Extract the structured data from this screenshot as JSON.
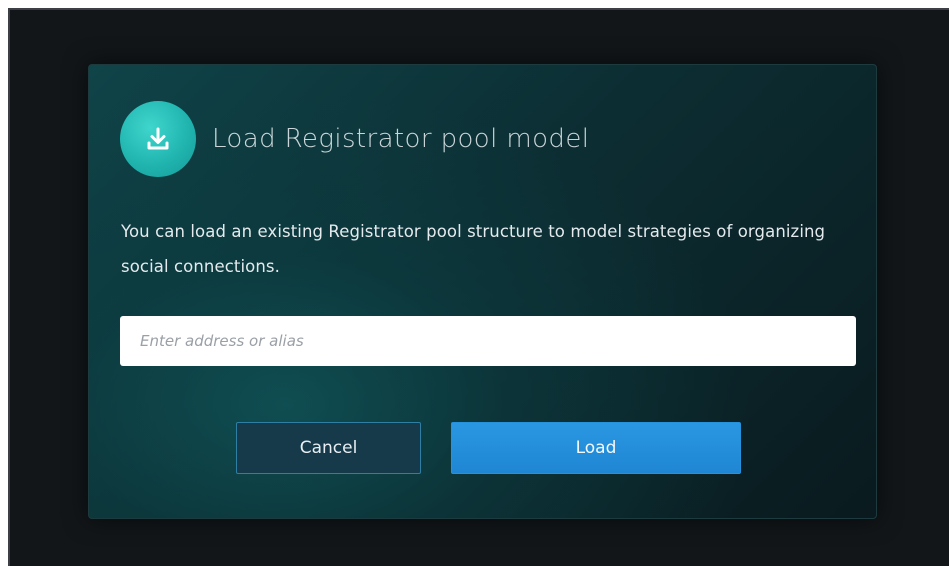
{
  "modal": {
    "title": "Load Registrator pool model",
    "icon": "download-icon",
    "description": "You can load an existing Registrator pool structure to model strategies of organizing social connections.",
    "input": {
      "placeholder": "Enter address or alias",
      "value": ""
    },
    "buttons": {
      "cancel_label": "Cancel",
      "load_label": "Load"
    }
  },
  "colors": {
    "icon_accent": "#1fb2ad",
    "primary_button": "#2190da",
    "secondary_button": "#173a4b",
    "secondary_border": "#2e7fa3"
  }
}
